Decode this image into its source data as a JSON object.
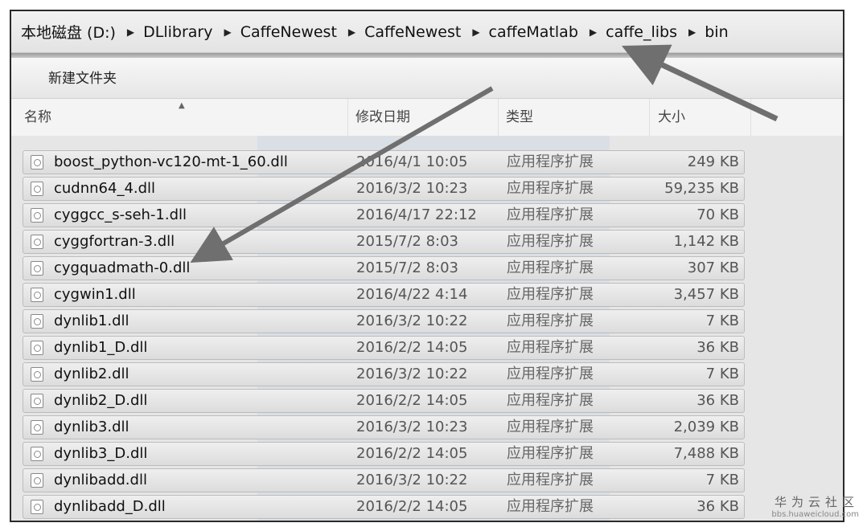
{
  "breadcrumb": [
    "本地磁盘 (D:)",
    "DLlibrary",
    "CaffeNewest",
    "CaffeNewest",
    "caffeMatlab",
    "caffe_libs",
    "bin"
  ],
  "toolbar": {
    "new_folder": "新建文件夹"
  },
  "columns": {
    "name": "名称",
    "date": "修改日期",
    "type": "类型",
    "size": "大小"
  },
  "files": [
    {
      "name": "boost_python-vc120-mt-1_60.dll",
      "date": "2016/4/1 10:05",
      "type": "应用程序扩展",
      "size": "249 KB"
    },
    {
      "name": "cudnn64_4.dll",
      "date": "2016/3/2 10:23",
      "type": "应用程序扩展",
      "size": "59,235 KB"
    },
    {
      "name": "cyggcc_s-seh-1.dll",
      "date": "2016/4/17 22:12",
      "type": "应用程序扩展",
      "size": "70 KB"
    },
    {
      "name": "cyggfortran-3.dll",
      "date": "2015/7/2 8:03",
      "type": "应用程序扩展",
      "size": "1,142 KB"
    },
    {
      "name": "cygquadmath-0.dll",
      "date": "2015/7/2 8:03",
      "type": "应用程序扩展",
      "size": "307 KB"
    },
    {
      "name": "cygwin1.dll",
      "date": "2016/4/22 4:14",
      "type": "应用程序扩展",
      "size": "3,457 KB"
    },
    {
      "name": "dynlib1.dll",
      "date": "2016/3/2 10:22",
      "type": "应用程序扩展",
      "size": "7 KB"
    },
    {
      "name": "dynlib1_D.dll",
      "date": "2016/2/2 14:05",
      "type": "应用程序扩展",
      "size": "36 KB"
    },
    {
      "name": "dynlib2.dll",
      "date": "2016/3/2 10:22",
      "type": "应用程序扩展",
      "size": "7 KB"
    },
    {
      "name": "dynlib2_D.dll",
      "date": "2016/2/2 14:05",
      "type": "应用程序扩展",
      "size": "36 KB"
    },
    {
      "name": "dynlib3.dll",
      "date": "2016/3/2 10:23",
      "type": "应用程序扩展",
      "size": "2,039 KB"
    },
    {
      "name": "dynlib3_D.dll",
      "date": "2016/2/2 14:05",
      "type": "应用程序扩展",
      "size": "7,488 KB"
    },
    {
      "name": "dynlibadd.dll",
      "date": "2016/3/2 10:22",
      "type": "应用程序扩展",
      "size": "7 KB"
    },
    {
      "name": "dynlibadd_D.dll",
      "date": "2016/2/2 14:05",
      "type": "应用程序扩展",
      "size": "36 KB"
    }
  ],
  "watermark": {
    "cn": "华为云社区",
    "url": "bbs.huaweicloud.com"
  },
  "colors": {
    "arrow": "#6f6f6f",
    "row_border": "#bcbcbc"
  }
}
